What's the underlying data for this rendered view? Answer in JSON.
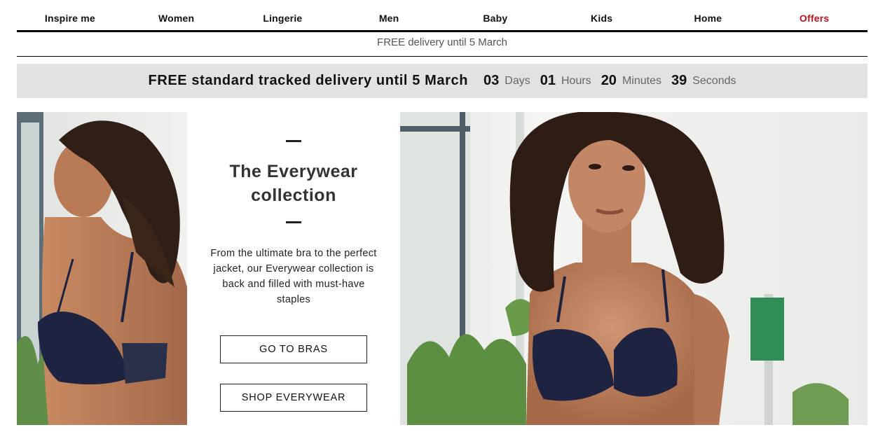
{
  "nav": {
    "items": [
      {
        "label": "Inspire me"
      },
      {
        "label": "Women"
      },
      {
        "label": "Lingerie"
      },
      {
        "label": "Men"
      },
      {
        "label": "Baby"
      },
      {
        "label": "Kids"
      },
      {
        "label": "Home"
      },
      {
        "label": "Offers"
      }
    ],
    "offers_color": "#c0141c"
  },
  "delivery_strip": {
    "text": "FREE delivery until 5 March"
  },
  "countdown": {
    "headline": "FREE standard tracked delivery until 5 March",
    "days": "03",
    "days_label": "Days",
    "hours": "01",
    "hours_label": "Hours",
    "minutes": "20",
    "minutes_label": "Minutes",
    "seconds": "39",
    "seconds_label": "Seconds"
  },
  "promo": {
    "title": "The Everywear collection",
    "description": "From the ultimate bra to the perfect jacket, our Everywear collection is back and filled with must-have staples",
    "button_bras": "GO TO BRAS",
    "button_everywear": "SHOP EVERYWEAR"
  },
  "colors": {
    "banner_bg": "#e2e2e2",
    "bra_navy": "#1d2340"
  }
}
